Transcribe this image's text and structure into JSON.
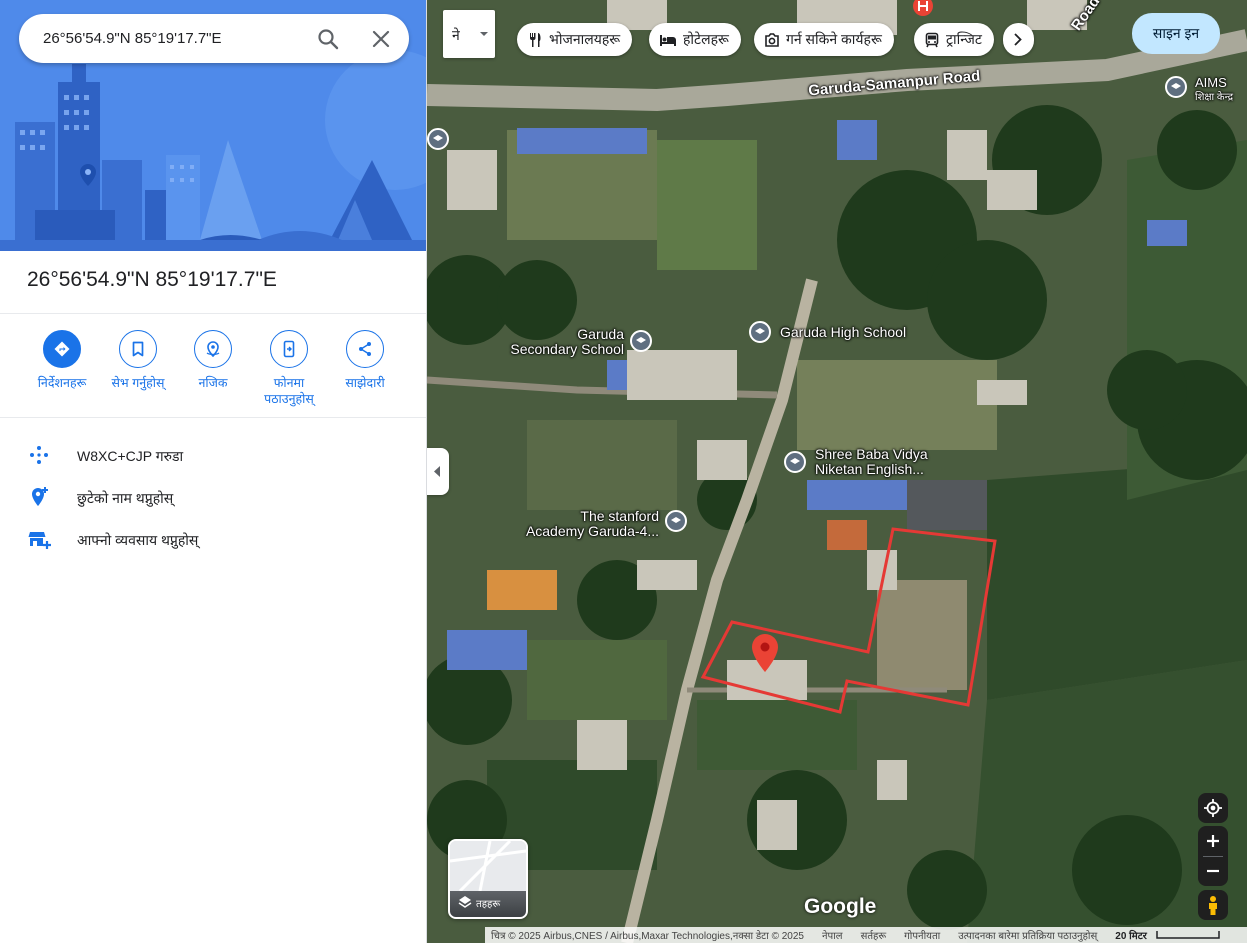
{
  "search": {
    "value": "26°56'54.9\"N 85°19'17.7\"E"
  },
  "place": {
    "coords": "26°56'54.9\"N 85°19'17.7\"E"
  },
  "actions": [
    {
      "label": "निर्देशनहरू",
      "icon": "directions-icon"
    },
    {
      "label": "सेभ गर्नुहोस्",
      "icon": "bookmark-icon"
    },
    {
      "label": "नजिक",
      "icon": "nearby-icon"
    },
    {
      "label": "फोनमा पठाउनुहोस्",
      "icon": "send-to-phone-icon"
    },
    {
      "label": "साझेदारी",
      "icon": "share-icon"
    }
  ],
  "info": [
    {
      "text": "W8XC+CJP गरुडा",
      "icon": "plus-code-icon"
    },
    {
      "text": "छुटेको नाम थप्नुहोस्",
      "icon": "add-place-icon"
    },
    {
      "text": "आफ्नो व्यवसाय थप्नुहोस्",
      "icon": "add-business-icon"
    }
  ],
  "top": {
    "lang": "ने",
    "chips": [
      {
        "label": "भोजनालयहरू",
        "icon": "restaurant-icon"
      },
      {
        "label": "होटेलहरू",
        "icon": "hotel-icon"
      },
      {
        "label": "गर्न सकिने कार्यहरू",
        "icon": "camera-icon"
      },
      {
        "label": "ट्रान्जिट",
        "icon": "transit-icon"
      }
    ],
    "signin": "साइन इन"
  },
  "map": {
    "road": "Garuda-Samanpur Road",
    "road_corner": "Road",
    "aims_1": "AIMS",
    "aims_2": "शिक्षा केन्द्र",
    "garuda_sec_1": "Garuda",
    "garuda_sec_2": "Secondary School",
    "garuda_high": "Garuda High School",
    "baba_1": "Shree Baba Vidya",
    "baba_2": "Niketan English...",
    "stanford_1": "The stanford",
    "stanford_2": "Academy Garuda-4...",
    "layers": "तहहरू",
    "google": "Google"
  },
  "footer": {
    "attribution": "चित्र © 2025 Airbus,CNES / Airbus,Maxar Technologies,नक्सा डेटा © 2025",
    "country": "नेपाल",
    "terms": "सर्तहरू",
    "privacy": "गोपनीयता",
    "feedback": "उत्पादनका बारेमा प्रतिक्रिया पठाउनुहोस्",
    "scale": "20 मिटर"
  },
  "colors": {
    "accent": "#1a73e8",
    "boundary": "#e53935",
    "pin": "#ea4335",
    "hero": "#4a86e8"
  }
}
